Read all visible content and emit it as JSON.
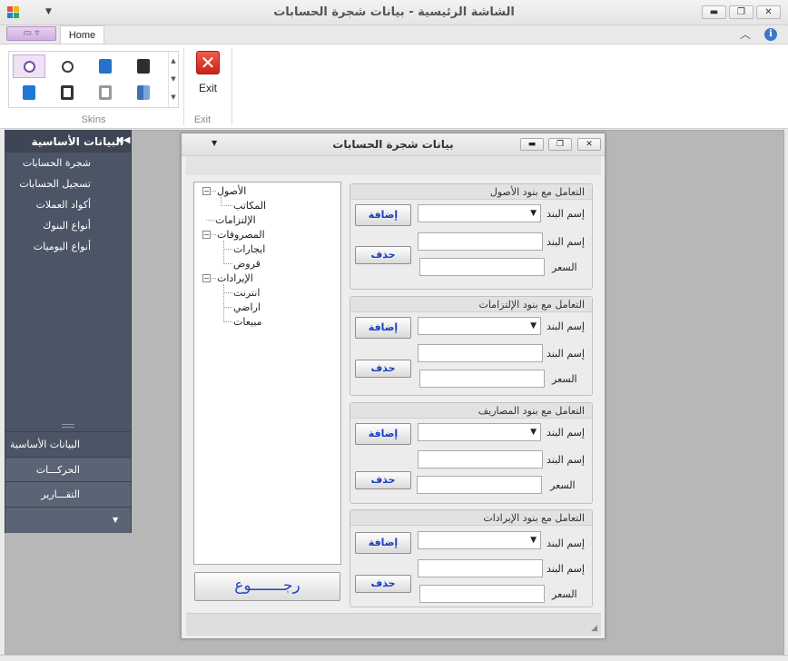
{
  "window": {
    "title": "الشاشة الرئيسية - بيانات شجرة الحسابات",
    "minimize": "▬",
    "maximize": "❐",
    "close": "✕"
  },
  "ribbon": {
    "tab_home": "Home",
    "group_skins": "Skins",
    "group_exit": "Exit",
    "exit_label": "Exit",
    "collapse_icon": "︿",
    "info_icon": "i"
  },
  "nav": {
    "header": "البيانات الأساسية",
    "items": [
      {
        "label": "شجرة الحسابات"
      },
      {
        "label": "تسجيل الحسابات"
      },
      {
        "label": "أكواد العملات"
      },
      {
        "label": "أنواع البنوك"
      },
      {
        "label": "أنواع اليوميات"
      }
    ],
    "groups": [
      {
        "label": "البيانات الأساسية"
      },
      {
        "label": "الحركـــات"
      },
      {
        "label": "التقـــارير"
      }
    ]
  },
  "child": {
    "title": "بيانات شجرة الحسابات",
    "back_button": "رجـــــــوع"
  },
  "tree": {
    "assets": "الأصول",
    "offices": "المكاتب",
    "liabilities": "الإلتزامات",
    "expenses": "المصروفات",
    "rents": "ايجارات",
    "loans": "قروض",
    "revenues": "الإيرادات",
    "internet": "انترنت",
    "lands": "اراضي",
    "sales": "مبيعات"
  },
  "groups": [
    {
      "title": "التعامل مع بنود الأصول",
      "add": "إضافة",
      "delete": "حذف",
      "item_name": "إسم البند",
      "price": "السعر"
    },
    {
      "title": "التعامل مع بنود الإلتزامات",
      "add": "إضافة",
      "delete": "حذف",
      "item_name": "إسم البند",
      "price": "السعر"
    },
    {
      "title": "التعامل مع بنود المصاريف",
      "add": "إضافة",
      "delete": "حذف",
      "item_name": "إسم البند",
      "price": "السعر"
    },
    {
      "title": "التعامل مع بنود الإيرادات",
      "add": "إضافة",
      "delete": "حذف",
      "item_name": "إسم البند",
      "price": "السعر"
    }
  ]
}
